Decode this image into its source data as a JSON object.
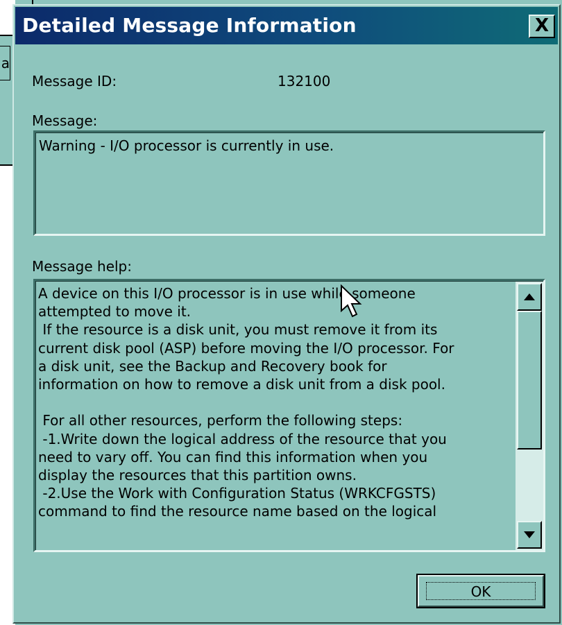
{
  "dialog": {
    "title": "Detailed Message Information",
    "close_label": "X",
    "message_id_label": "Message ID:",
    "message_id_value": "132100",
    "message_label": "Message:",
    "message_text": "Warning - I/O processor is currently in use.",
    "message_help_label": "Message help:",
    "message_help_lines": [
      "A device on this I/O processor is in use while someone",
      "attempted to move it.",
      " If the resource is a disk unit, you must remove it from its",
      "current disk pool (ASP) before moving the I/O processor. For",
      "a disk unit, see the Backup and Recovery book for",
      "information on how to remove a disk unit from a disk pool.",
      "",
      " For all other resources, perform the following steps:",
      " -1.Write down the logical address of the resource that you",
      "need to vary off. You can find this information when you",
      "display the resources that this partition owns.",
      " -2.Use the Work with Configuration Status (WRKCFGSTS)",
      "command to find the resource name based on the logical"
    ],
    "ok_label": "OK"
  },
  "background": {
    "tab_fragment": "a"
  },
  "icons": {
    "scroll_up": "triangle-up-icon",
    "scroll_down": "triangle-down-icon",
    "cursor": "mouse-pointer-icon"
  },
  "colors": {
    "face": "#8ec5bd",
    "titlebar_start": "#0c2a6a",
    "titlebar_end": "#0f6b76"
  }
}
